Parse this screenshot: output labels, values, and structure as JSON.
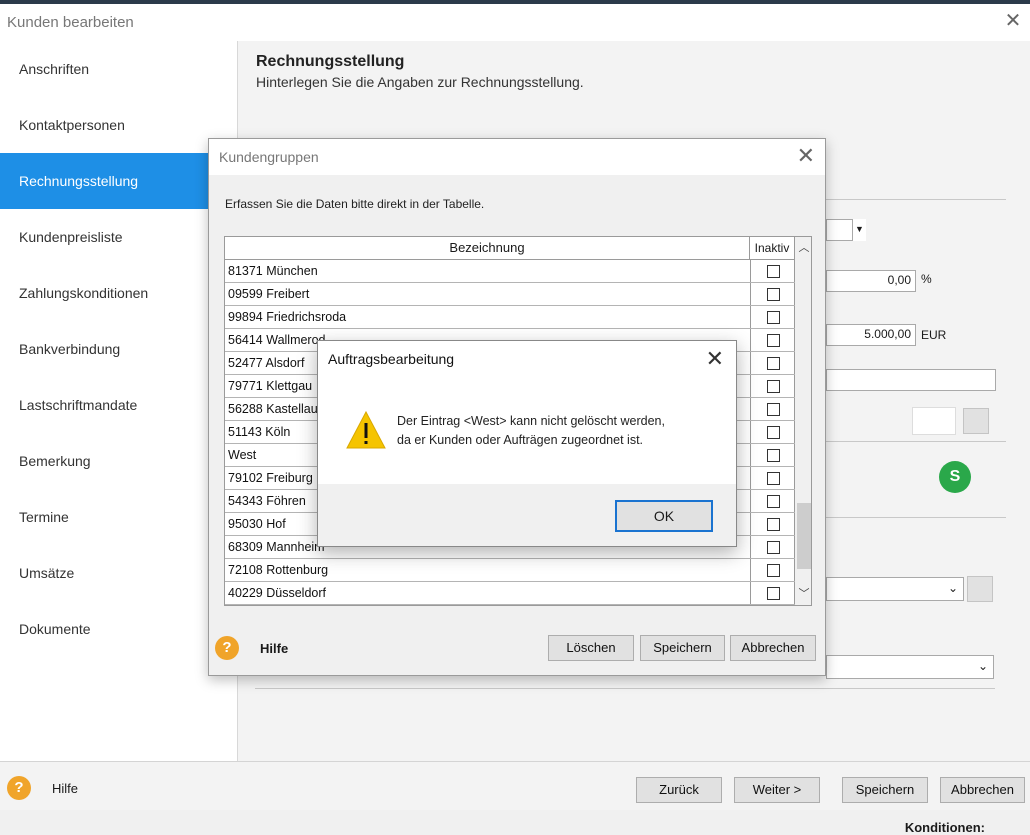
{
  "window": {
    "title": "Kunden bearbeiten"
  },
  "sidebar": {
    "items": [
      {
        "label": "Anschriften"
      },
      {
        "label": "Kontaktpersonen"
      },
      {
        "label": "Rechnungsstellung",
        "active": true
      },
      {
        "label": "Kundenpreisliste"
      },
      {
        "label": "Zahlungskonditionen"
      },
      {
        "label": "Bankverbindung"
      },
      {
        "label": "Lastschriftmandate"
      },
      {
        "label": "Bemerkung"
      },
      {
        "label": "Termine"
      },
      {
        "label": "Umsätze"
      },
      {
        "label": "Dokumente"
      }
    ]
  },
  "content": {
    "title": "Rechnungsstellung",
    "subtitle": "Hinterlegen Sie die Angaben zur Rechnungsstellung.",
    "field_percent_value": "0,00",
    "field_percent_unit": "%",
    "field_amount_value": "5.000,00",
    "field_amount_unit": "EUR",
    "badge_glyph": "S"
  },
  "footer": {
    "help_label": "Hilfe",
    "back_label": "Zurück",
    "next_label": "Weiter >",
    "save_label": "Speichern",
    "cancel_label": "Abbrechen"
  },
  "below": {
    "text": "Konditionen:"
  },
  "kundengruppen": {
    "title": "Kundengruppen",
    "intro": "Erfassen Sie die Daten bitte direkt in der Tabelle.",
    "columns": {
      "bezeichnung": "Bezeichnung",
      "inaktiv": "Inaktiv"
    },
    "rows": [
      "81371 München",
      "09599 Freibert",
      "99894 Friedrichsroda",
      "56414 Wallmerod",
      "52477 Alsdorf",
      "79771 Klettgau",
      "56288 Kastellaun",
      "51143 Köln",
      "West",
      "79102 Freiburg",
      "54343 Föhren",
      "95030 Hof",
      "68309 Mannheim",
      "72108 Rottenburg",
      "40229 Düsseldorf"
    ],
    "help_label": "Hilfe",
    "delete_label": "Löschen",
    "save_label": "Speichern",
    "cancel_label": "Abbrechen"
  },
  "messagebox": {
    "title": "Auftragsbearbeitung",
    "text": "Der Eintrag <West> kann nicht gelöscht werden,\nda er Kunden oder Aufträgen zugeordnet ist.",
    "ok_label": "OK"
  },
  "colors": {
    "accent": "#1e8fe6",
    "help": "#f0a42a",
    "warning": "#f5c400",
    "green": "#2aa84a"
  }
}
